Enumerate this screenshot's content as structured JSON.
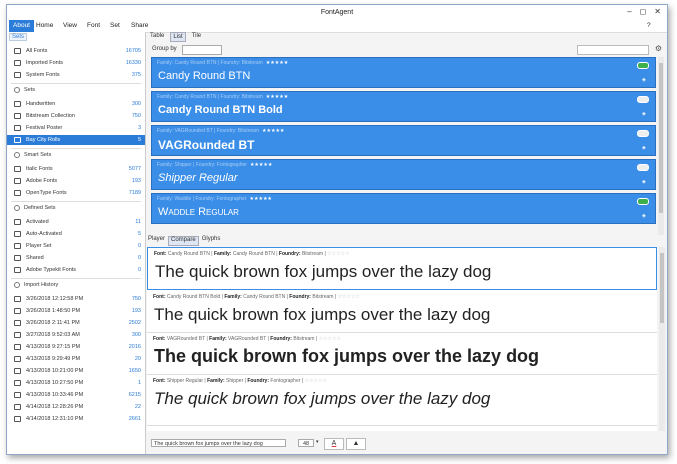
{
  "window": {
    "title": "FontAgent",
    "controls": [
      "–",
      "◻",
      "✕"
    ]
  },
  "menu": {
    "items": [
      "About",
      "Home",
      "View",
      "Font",
      "Set",
      "Share"
    ],
    "help": "?"
  },
  "sidebar": {
    "tab": "Sets",
    "top": [
      {
        "label": "All Fonts",
        "count": "16705"
      },
      {
        "label": "Imported Fonts",
        "count": "16330"
      },
      {
        "label": "System Fonts",
        "count": "375"
      }
    ],
    "sets_header": "Sets",
    "sets": [
      {
        "label": "Handwritten",
        "count": "300"
      },
      {
        "label": "Bitstream Collection",
        "count": "750"
      },
      {
        "label": "Festival Poster",
        "count": "3"
      },
      {
        "label": "Bay City Rolls",
        "count": "5"
      }
    ],
    "smart_header": "Smart Sets",
    "smart": [
      {
        "label": "Italic Fonts",
        "count": "5077"
      },
      {
        "label": "Adobe Fonts",
        "count": "193"
      },
      {
        "label": "OpenType Fonts",
        "count": "7189"
      }
    ],
    "defined_header": "Defined Sets",
    "defined": [
      {
        "label": "Activated",
        "count": "11"
      },
      {
        "label": "Auto-Activated",
        "count": "5"
      },
      {
        "label": "Player Set",
        "count": "0"
      },
      {
        "label": "Shared",
        "count": "0"
      },
      {
        "label": "Adobe Typekit Fonts",
        "count": "0"
      }
    ],
    "history_header": "Import History",
    "history": [
      {
        "label": "3/26/2018 12:12:58 PM",
        "count": "750"
      },
      {
        "label": "3/26/2018 1:48:50 PM",
        "count": "193"
      },
      {
        "label": "3/26/2018 2:11:41 PM",
        "count": "2502"
      },
      {
        "label": "3/27/2018 9:52:03 AM",
        "count": "300"
      },
      {
        "label": "4/13/2018 9:27:15 PM",
        "count": "2016"
      },
      {
        "label": "4/13/2018 9:29:49 PM",
        "count": "20"
      },
      {
        "label": "4/13/2018 10:21:00 PM",
        "count": "1650"
      },
      {
        "label": "4/13/2018 10:27:50 PM",
        "count": "1"
      },
      {
        "label": "4/13/2018 10:33:46 PM",
        "count": "6215"
      },
      {
        "label": "4/14/2018 12:28:26 PM",
        "count": "22"
      },
      {
        "label": "4/14/2018 12:31:10 PM",
        "count": "2661"
      }
    ]
  },
  "main": {
    "view_tabs": [
      "Table",
      "List",
      "Tile"
    ],
    "group_by_label": "Group by",
    "list": [
      {
        "meta": "Family: Candy Round BTN | Foundry: Bitstream",
        "stars": "★★★★★",
        "sample": "Candy Round BTN"
      },
      {
        "meta": "Family: Candy Round BTN | Foundry: Bitstream",
        "stars": "★★★★★",
        "sample": "Candy Round BTN Bold"
      },
      {
        "meta": "Family: VAGRounded BT | Foundry: Bitstream",
        "stars": "★★★★★",
        "sample": "VAGRounded BT"
      },
      {
        "meta": "Family: Shipper | Foundry: Fontographer",
        "stars": "★★★★★",
        "sample": "Shipper Regular"
      },
      {
        "meta": "Family: Waddle | Foundry: Fontographer",
        "stars": "★★★★★",
        "sample": "Waddle Regular"
      }
    ],
    "lower_tabs": [
      "Player",
      "Compare",
      "Glyphs"
    ],
    "compare": [
      {
        "font": "Candy Round BTN",
        "family": "Candy Round BTN",
        "foundry": "Bitstream",
        "stars": "☆☆☆☆☆",
        "sample": "The quick brown fox jumps over the lazy dog"
      },
      {
        "font": "Candy Round BTN Bold",
        "family": "Candy Round BTN",
        "foundry": "Bitstream",
        "stars": "☆☆☆☆☆",
        "sample": "The quick brown fox jumps over the lazy dog"
      },
      {
        "font": "VAGRounded BT",
        "family": "VAGRounded BT",
        "foundry": "Bitstream",
        "stars": "☆☆☆☆☆",
        "sample": "The quick brown fox jumps over the lazy dog"
      },
      {
        "font": "Shipper Regular",
        "family": "Shipper",
        "foundry": "Fontographer",
        "stars": "☆☆☆☆☆",
        "sample": "The quick brown fox jumps over the lazy dog"
      }
    ],
    "labels": {
      "font": "Font:",
      "family": "Family:",
      "foundry": "Foundry:"
    },
    "bottom": {
      "sample_text": "The quick brown fox jumps over the lazy dog",
      "size": "48",
      "color_glyph": "A",
      "bg_glyph": "▲"
    }
  },
  "colors": {
    "accent": "#2b7cd8",
    "card": "#3b8ee8"
  }
}
